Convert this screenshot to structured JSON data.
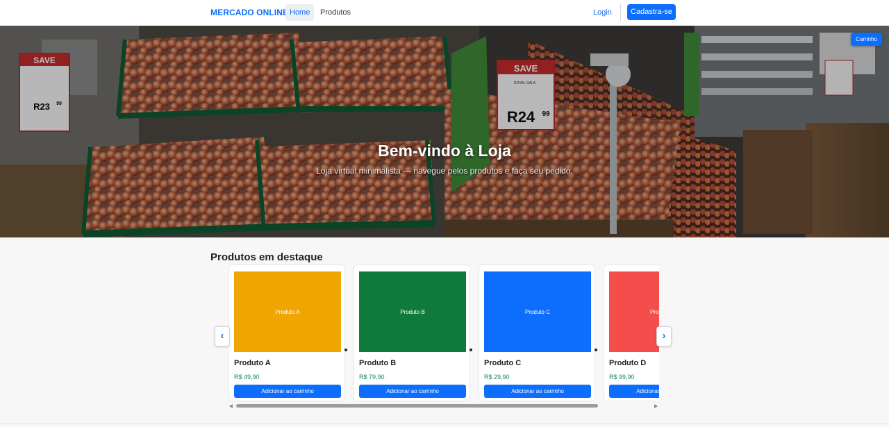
{
  "navbar": {
    "brand": "MERCADO ONLINE",
    "links": [
      {
        "label": "Home",
        "active": true
      },
      {
        "label": "Produtos",
        "active": false
      }
    ],
    "login_label": "Login",
    "signup_label": "Cadastra-se"
  },
  "hero": {
    "title": "Bem-vindo à Loja",
    "subtitle": "Loja virtual minimalista — navegue pelos produtos e faça seu pedido.",
    "cart_label": "Carrinho",
    "sign_left": {
      "top": "SAVE",
      "price": "R23",
      "cents": "99"
    },
    "sign_right": {
      "top": "SAVE",
      "name": "ROYAL GALA",
      "price": "R24",
      "cents": "99"
    }
  },
  "featured": {
    "title": "Produtos em destaque",
    "products": [
      {
        "name": "Produto A",
        "image_label": "Produto A",
        "price": "R$ 49,90",
        "button": "Adicionar ao carrinho",
        "color": "#f0a500"
      },
      {
        "name": "Produto B",
        "image_label": "Produto B",
        "price": "R$ 79,90",
        "button": "Adicionar ao carrinho",
        "color": "#0f7a3a"
      },
      {
        "name": "Produto C",
        "image_label": "Produto C",
        "price": "R$ 29,90",
        "button": "Adicionar ao carrinho",
        "color": "#0d6efd"
      },
      {
        "name": "Produto D",
        "image_label": "Produto D",
        "price": "R$ 99,90",
        "button": "Adicionar ao carrinho",
        "color": "#f54c4c"
      }
    ],
    "prev_icon": "‹",
    "next_icon": "›"
  },
  "colors": {
    "accent": "#0d6efd",
    "price": "#198754"
  }
}
